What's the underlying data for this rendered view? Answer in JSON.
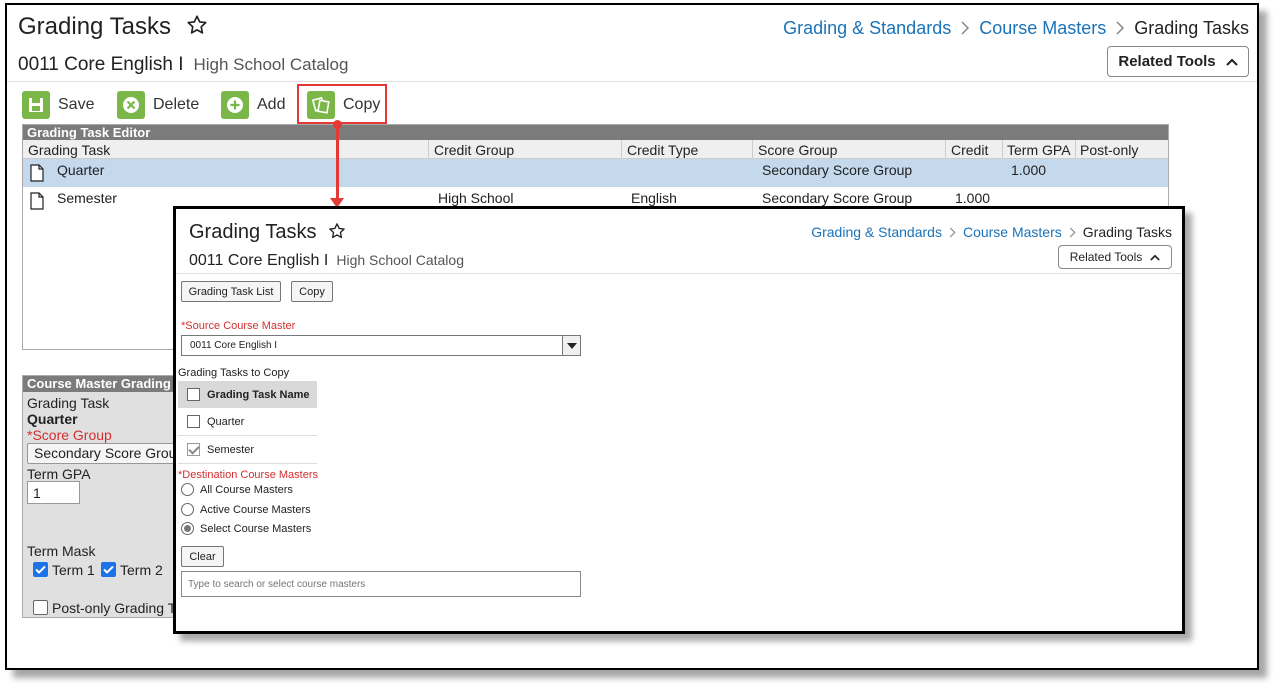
{
  "main": {
    "title": "Grading Tasks",
    "breadcrumbs": [
      "Grading & Standards",
      "Course Masters",
      "Grading Tasks"
    ],
    "course_name": "0011 Core English I",
    "catalog": "High School Catalog",
    "related_tools": "Related Tools",
    "toolbar": {
      "save": "Save",
      "delete": "Delete",
      "add": "Add",
      "copy": "Copy"
    },
    "editor": {
      "title": "Grading Task Editor",
      "columns": [
        "Grading Task",
        "Credit Group",
        "Credit Type",
        "Score Group",
        "Credit",
        "Term GPA",
        "Post-only"
      ],
      "rows": [
        {
          "task": "Quarter",
          "credit_group": "",
          "credit_type": "",
          "score_group": "Secondary Score Group",
          "credit": "",
          "term_gpa": "1.000"
        },
        {
          "task": "Semester",
          "credit_group": "High School",
          "credit_type": "English",
          "score_group": "Secondary Score Group",
          "credit": "1.000",
          "term_gpa": ""
        }
      ]
    },
    "cmg": {
      "title": "Course Master Grading",
      "grading_task_label": "Grading Task",
      "grading_task_value": "Quarter",
      "score_group_label": "*Score Group",
      "score_group_value": "Secondary Score Grou",
      "term_gpa_label": "Term GPA",
      "term_gpa_value": "1",
      "term_mask_label": "Term Mask",
      "term1": "Term 1",
      "term2": "Term 2",
      "post_only": "Post-only Grading T"
    }
  },
  "overlay": {
    "title": "Grading Tasks",
    "breadcrumbs": [
      "Grading & Standards",
      "Course Masters",
      "Grading Tasks"
    ],
    "course_name": "0011 Core English I",
    "catalog": "High School Catalog",
    "related_tools": "Related Tools",
    "grading_task_list_btn": "Grading Task List",
    "copy_btn": "Copy",
    "source_label": "*Source Course Master",
    "source_value": "0011 Core English I",
    "tasks_to_copy_label": "Grading Tasks to Copy",
    "task_table_header": "Grading Task Name",
    "tasks": [
      {
        "name": "Quarter",
        "checked": false
      },
      {
        "name": "Semester",
        "checked": true
      }
    ],
    "destination_label": "*Destination Course Masters",
    "radio_options": [
      "All Course Masters",
      "Active Course Masters",
      "Select Course Masters"
    ],
    "selected_radio": "Select Course Masters",
    "clear_btn": "Clear",
    "search_placeholder": "Type to search or select course masters"
  },
  "colors": {
    "link": "#1a73b8",
    "toolbar_green": "#7ab648",
    "highlight_red": "#e53935",
    "selected_row": "#c5d9ec",
    "header_gray": "#7b7b7b"
  }
}
